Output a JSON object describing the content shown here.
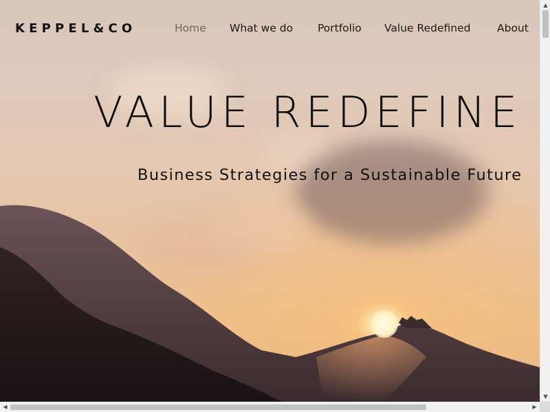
{
  "brand": {
    "logo_text": "KEPPEL&CO"
  },
  "nav": {
    "items": [
      {
        "label": "Home",
        "active": true
      },
      {
        "label": "What we do",
        "active": false
      },
      {
        "label": "Portfolio",
        "active": false
      },
      {
        "label": "Value Redefined",
        "active": false
      },
      {
        "label": "About",
        "active": false
      }
    ]
  },
  "hero": {
    "title": "VALUE REDEFINE",
    "subtitle": "Business Strategies for a Sustainable Future",
    "background_image": "sunset over mountain silhouette with clouds"
  },
  "scrollbars": {
    "vertical_up_icon": "▲",
    "vertical_down_icon": "▼",
    "horizontal_left_icon": "◀",
    "horizontal_right_icon": "▶"
  },
  "colors": {
    "text_dark": "#111111",
    "nav_active": "#666666",
    "sky_top": "#d9c6bb",
    "sky_bottom": "#e3b184",
    "hills": "#2a1f1f"
  }
}
